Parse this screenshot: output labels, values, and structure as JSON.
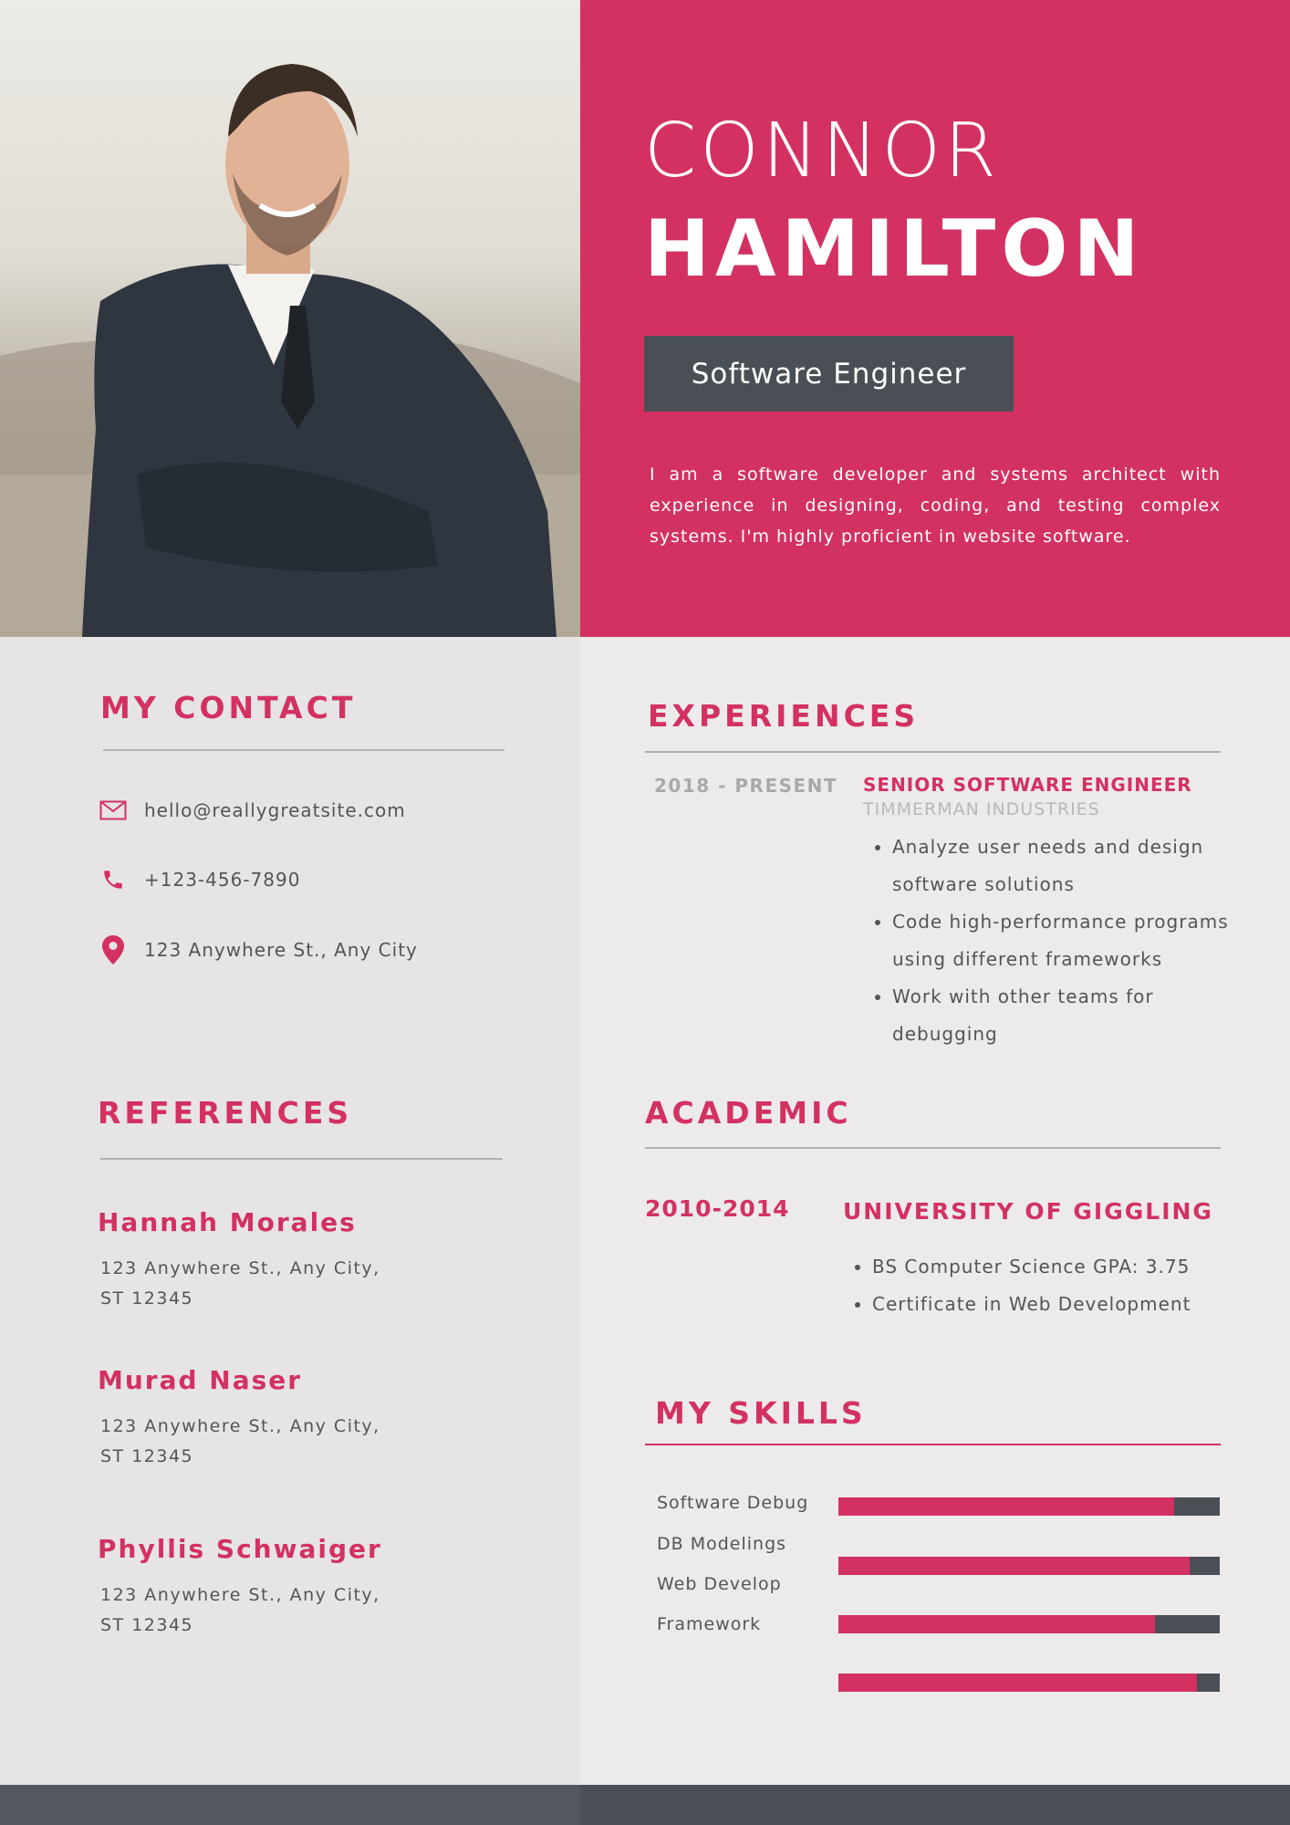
{
  "header": {
    "first_name": "CONNOR",
    "last_name": "HAMILTON",
    "job_title": "Software Engineer",
    "summary": "I am a software developer and systems architect with experience in designing, coding, and testing complex systems. I'm highly proficient in website software."
  },
  "contact": {
    "heading": "MY CONTACT",
    "email": "hello@reallygreatsite.com",
    "phone": "+123-456-7890",
    "address": "123 Anywhere St., Any City"
  },
  "references": {
    "heading": "REFERENCES",
    "items": [
      {
        "name": "Hannah Morales",
        "address": "123 Anywhere St., Any City, ST 12345"
      },
      {
        "name": "Murad Naser",
        "address": "123 Anywhere St., Any City, ST 12345"
      },
      {
        "name": "Phyllis Schwaiger",
        "address": "123 Anywhere St., Any City, ST 12345"
      }
    ]
  },
  "experiences": {
    "heading": "EXPERIENCES",
    "items": [
      {
        "dates": "2018 - PRESENT",
        "role": "SENIOR SOFTWARE ENGINEER",
        "company": "TIMMERMAN INDUSTRIES",
        "bullets": [
          "Analyze user needs and design software solutions",
          "Code high-performance programs using different frameworks",
          "Work with other teams for debugging"
        ]
      }
    ]
  },
  "academic": {
    "heading": "ACADEMIC",
    "years": "2010-2014",
    "school": "UNIVERSITY OF GIGGLING",
    "bullets": [
      "BS Computer Science GPA: 3.75",
      "Certificate in Web Development"
    ]
  },
  "skills": {
    "heading": "MY SKILLS",
    "items": [
      {
        "label": "Software Debug",
        "level": 0.88
      },
      {
        "label": "DB Modelings",
        "level": 0.92
      },
      {
        "label": "Web Develop",
        "level": 0.83
      },
      {
        "label": "Framework",
        "level": 0.94
      }
    ]
  },
  "colors": {
    "accent": "#d33162",
    "dark": "#4a4f55",
    "light_bg": "#eceaeb"
  },
  "icons": {
    "photo": "portrait-photo",
    "email": "envelope-icon",
    "phone": "phone-icon",
    "address": "map-pin-icon"
  }
}
